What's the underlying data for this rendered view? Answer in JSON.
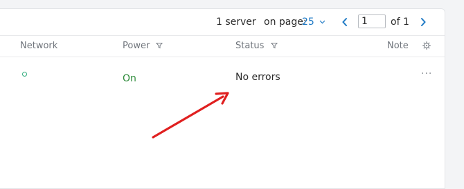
{
  "pagination": {
    "count_text": "1 server",
    "on_page_label": "on page:",
    "per_page_value": "25",
    "current_page": "1",
    "of_label": "of 1"
  },
  "table": {
    "columns": [
      {
        "label": "Network"
      },
      {
        "label": "Power"
      },
      {
        "label": "Status"
      },
      {
        "label": "Note"
      }
    ],
    "rows": [
      {
        "power": "On",
        "status": "No errors",
        "actions": "···"
      }
    ]
  },
  "icons": {
    "prev": "chevron-left-icon",
    "next": "chevron-right-icon",
    "filter": "filter-icon",
    "settings": "gear-icon",
    "network_status": "circle-icon",
    "annotation": "red-arrow"
  },
  "colors": {
    "accent": "#1f7ac5",
    "power_on": "#2e8b3a",
    "network_ok": "#2dab7a",
    "annotation": "#e02020"
  }
}
